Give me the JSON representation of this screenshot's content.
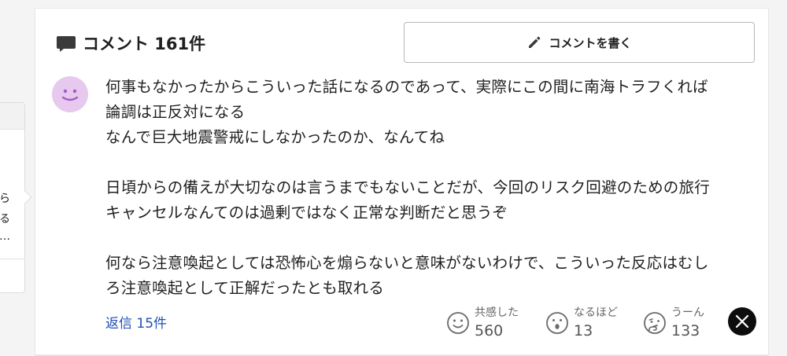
{
  "side_card": {
    "fragments": [
      "ら",
      "る",
      "…"
    ]
  },
  "header": {
    "title": "コメント 161件",
    "write_button_label": "コメントを書く"
  },
  "comment": {
    "paragraphs": [
      [
        "何事もなかったからこういった話になるのであって、実際にこの間に南海トラフくれば",
        "論調は正反対になる",
        "なんで巨大地震警戒にしなかったのか、なんてね"
      ],
      [
        "日頃からの備えが大切なのは言うまでもないことだが、今回のリスク回避のための旅行",
        "キャンセルなんてのは過剰ではなく正常な判断だと思うぞ"
      ],
      [
        "何なら注意喚起としては恐怖心を煽らないと意味がないわけで、こういった反応はむし",
        "ろ注意喚起として正解だったとも取れる"
      ]
    ],
    "reply_link": "返信 15件"
  },
  "reactions": [
    {
      "label": "共感した",
      "count": "560",
      "icon": "smile-face-icon"
    },
    {
      "label": "なるほど",
      "count": "13",
      "icon": "surprised-face-icon"
    },
    {
      "label": "うーん",
      "count": "133",
      "icon": "thinking-face-icon"
    }
  ],
  "share": {
    "icon": "x-logo-icon"
  },
  "colors": {
    "avatar_bg": "#e7c8ef",
    "link": "#1f4fb5",
    "x_button_bg": "#0d0d0d"
  }
}
